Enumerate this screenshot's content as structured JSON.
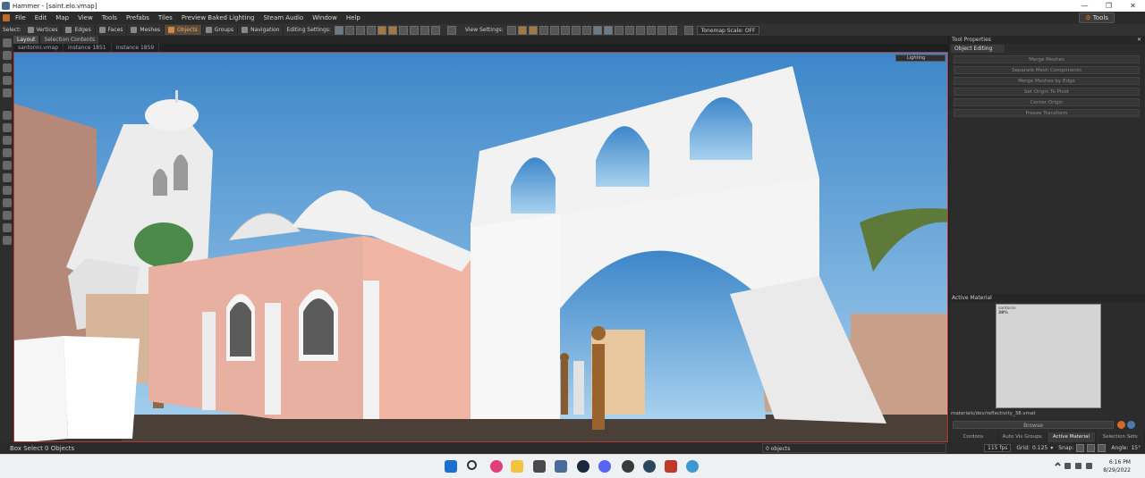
{
  "window": {
    "title": "Hammer - [saint.elo.vmap]",
    "controls": [
      "—",
      "❐",
      "✕"
    ]
  },
  "menu": {
    "items": [
      "File",
      "Edit",
      "Map",
      "View",
      "Tools",
      "Prefabs",
      "Tiles",
      "Preview Baked Lighting",
      "Steam Audio",
      "Window",
      "Help"
    ],
    "tools_button": "Tools"
  },
  "toolbar": {
    "select_label": "Select:",
    "modes": [
      {
        "label": "Vertices",
        "active": false
      },
      {
        "label": "Edges",
        "active": false
      },
      {
        "label": "Faces",
        "active": false
      },
      {
        "label": "Meshes",
        "active": false
      },
      {
        "label": "Objects",
        "active": true
      },
      {
        "label": "Groups",
        "active": false
      },
      {
        "label": "Navigation",
        "active": false
      }
    ],
    "editing_settings_label": "Editing Settings:",
    "view_settings_label": "View Settings:",
    "tonemap_scale": "Tonemap Scale: OFF"
  },
  "tabs": {
    "items": [
      "Layout",
      "Selection Contents"
    ]
  },
  "documents": {
    "items": [
      "santorini.vmap",
      "instance 1851",
      "instance 1859"
    ]
  },
  "viewport": {
    "lighting_mode": "Lighting",
    "sky_color": "#6aa9dd",
    "wall_pink": "#e7b0a0",
    "wall_white": "#f4f4f4"
  },
  "status": {
    "text": "Box Select 0 Objects",
    "object_count": "0 objects",
    "fps": "115 fps",
    "grid_label": "Grid:",
    "grid_value": "0.125",
    "snap_label": "Snap:",
    "angle_label": "Angle:",
    "angle_value": "15°"
  },
  "tool_properties": {
    "title": "Tool Properties",
    "tab": "Object Editing",
    "buttons": [
      "Merge Meshes",
      "Separate Mesh Components",
      "Merge Meshes by Edge",
      "Set Origin To Pivot",
      "Center Origin",
      "Freeze Transform"
    ]
  },
  "active_material": {
    "title": "Active Material",
    "preview_text_top": "santorini",
    "preview_text_value": "38%",
    "path": "materials/dev/reflectivity_38.vmat",
    "browse_label": "Browse",
    "tabs": [
      "Cordons",
      "Auto Vis Groups",
      "Active Material",
      "Selection Sets"
    ],
    "active_tab": "Active Material"
  },
  "taskbar": {
    "time": "6:16 PM",
    "date": "8/29/2022",
    "accent": "#1a5fb4"
  }
}
